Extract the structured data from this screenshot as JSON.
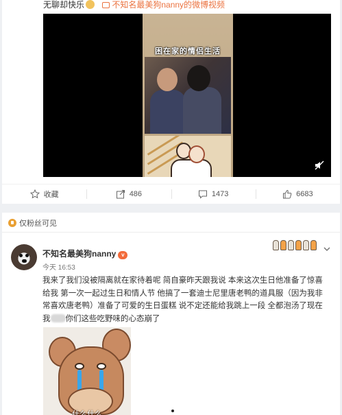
{
  "top_post": {
    "text_fragment": "无聊却快乐",
    "video_link": "不知名最美狗nanny的微博视频",
    "video_caption": "困在家的情侣生活",
    "actions": [
      {
        "label": "收藏",
        "icon": "star-icon"
      },
      {
        "label": "486",
        "icon": "repost-icon"
      },
      {
        "label": "1473",
        "icon": "comment-icon"
      },
      {
        "label": "6683",
        "icon": "like-icon"
      }
    ]
  },
  "second_post": {
    "visibility": "仅粉丝可见",
    "username": "不知名最美狗nanny",
    "vip_badge": "v",
    "timestamp": "今天 16:53",
    "body_part1": "我来了我们没被隔离就在家待着呢 简自豪昨天跟我说 本来这次生日他准备了惊喜给我 第一次一起过生日和情人节 他搞了一套迪士尼里唐老鸭的道具服（因为我非常喜欢唐老鸭）准备了可爱的生日蛋糕 说不定还能给我跳上一段 全都泡汤了现在我",
    "body_part2": "你们这些吃野味的心态崩了",
    "meme_caption": "什么什么"
  },
  "colors": {
    "link_orange": "#eb7340",
    "background": "#eef0f3",
    "tear_blue": "#39a6ea"
  }
}
